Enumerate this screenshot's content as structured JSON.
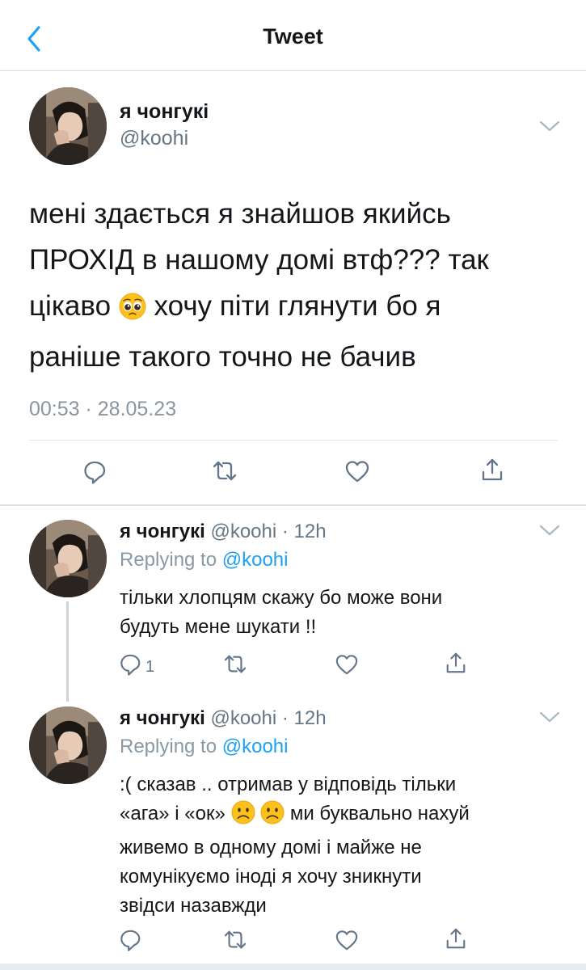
{
  "header": {
    "title": "Tweet"
  },
  "tweet": {
    "author_name": "я чонгукі",
    "author_handle": "@koohi",
    "text_lines": [
      "мені здається я знайшов якийсь",
      "ПРОХІД в нашому домі втф??? так",
      "цікаво",
      "хочу піти глянути бо я",
      "раніше такого точно не бачив"
    ],
    "emoji": "pleading-face-emoji",
    "timestamp": "00:53 · 28.05.23"
  },
  "replies": [
    {
      "author_name": "я чонгукі",
      "author_handle": "@koohi",
      "time": "12h",
      "replying_label": "Replying to",
      "replying_to": "@koohi",
      "text_lines": [
        "тільки хлопцям скажу бо може вони",
        "будуть мене шукати !!"
      ],
      "reply_count": "1"
    },
    {
      "author_name": "я чонгукі",
      "author_handle": "@koohi",
      "time": "12h",
      "replying_label": "Replying to",
      "replying_to": "@koohi",
      "text_lines": [
        ":( сказав .. отримав у відповідь тільки",
        "«ага» і «ок»",
        "ми буквально нахуй",
        "живемо в одному домі і майже не",
        "комунікуємо іноді я хочу зникнути",
        "звідси назавжди"
      ],
      "emoji": "slightly-frowning-face-emoji",
      "reply_count": ""
    }
  ],
  "colors": {
    "accent": "#1da1f2",
    "text": "#14171a",
    "secondary": "#657786",
    "icon": "#64758a",
    "border": "#e1e5e8"
  }
}
